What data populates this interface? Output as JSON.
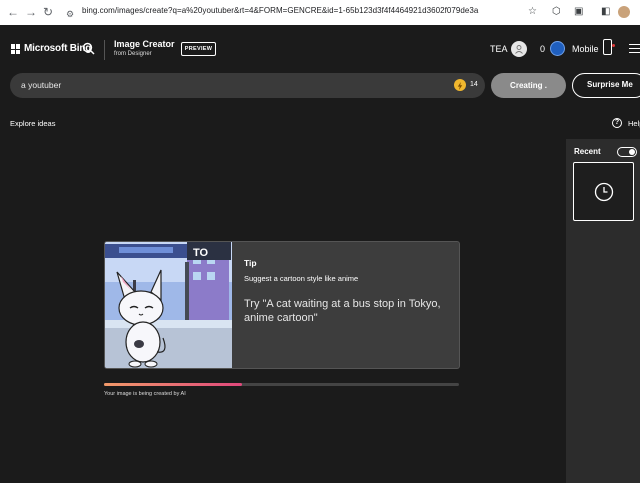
{
  "browser": {
    "url": "bing.com/images/create?q=a%20youtuber&rt=4&FORM=GENCRE&id=1-65b123d3f4f4464921d3602f079de3a"
  },
  "header": {
    "brand": "Microsoft Bing",
    "app_title": "Image Creator",
    "app_subtitle": "from Designer",
    "preview_badge": "PREVIEW",
    "username": "TEA",
    "rewards_count": "0",
    "mobile_label": "Mobile"
  },
  "prompt": {
    "value": "a youtuber",
    "boosts": "14",
    "create_label": "Creating .",
    "surprise_label": "Surprise Me"
  },
  "explore": {
    "label": "Explore ideas",
    "help_label": "Help"
  },
  "recent": {
    "title": "Recent"
  },
  "tip": {
    "title": "Tip",
    "subtitle": "Suggest a cartoon style like anime",
    "example": "Try \"A cat waiting at a bus stop in Tokyo, anime cartoon\"",
    "sign_text": "TO"
  },
  "progress": {
    "fraction": 0.39,
    "text": "Your image is being created by AI"
  },
  "colors": {
    "background": "#1b1b1b",
    "progress_start": "#f29a6a",
    "progress_end": "#e0487c",
    "boost": "#f0b72e"
  }
}
